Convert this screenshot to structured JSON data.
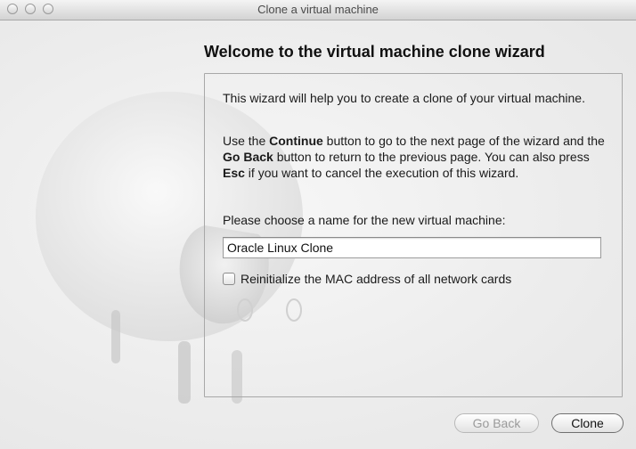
{
  "window": {
    "title": "Clone a virtual machine"
  },
  "wizard": {
    "heading": "Welcome to the virtual machine clone wizard",
    "intro": "This wizard will help you to create a clone of your virtual machine.",
    "nav_help": {
      "part1": "Use the ",
      "continue_label": "Continue",
      "part2": " button to go to the next page of the wizard and the ",
      "goback_label": "Go Back",
      "part3": " button to return to the previous page. You can also press ",
      "esc_label": "Esc",
      "part4": " if you want to cancel the execution of this wizard."
    },
    "name_prompt": "Please choose a name for the new virtual machine:",
    "name_value": "Oracle Linux Clone",
    "reinit_mac_label": "Reinitialize the MAC address of all network cards",
    "reinit_mac_checked": false
  },
  "buttons": {
    "go_back": "Go Back",
    "clone": "Clone"
  }
}
